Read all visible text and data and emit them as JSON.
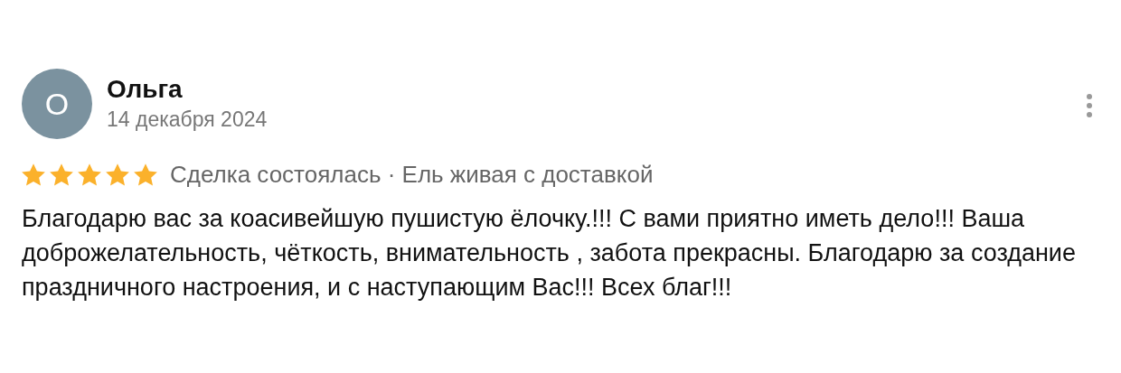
{
  "review": {
    "avatar_letter": "О",
    "author": "Ольга",
    "date": "14 декабря 2024",
    "stars": 5,
    "meta": "Сделка состоялась · Ель живая с доставкой",
    "text": "Благодарю вас за коасивейшую пушистую ёлочку.!!! С вами приятно иметь дело!!! Ваша доброжелательность, чёткость, внимательность , забота прекрасны. Благодарю за создание праздничного настроения, и с наступающим Вас!!! Всех благ!!!"
  }
}
